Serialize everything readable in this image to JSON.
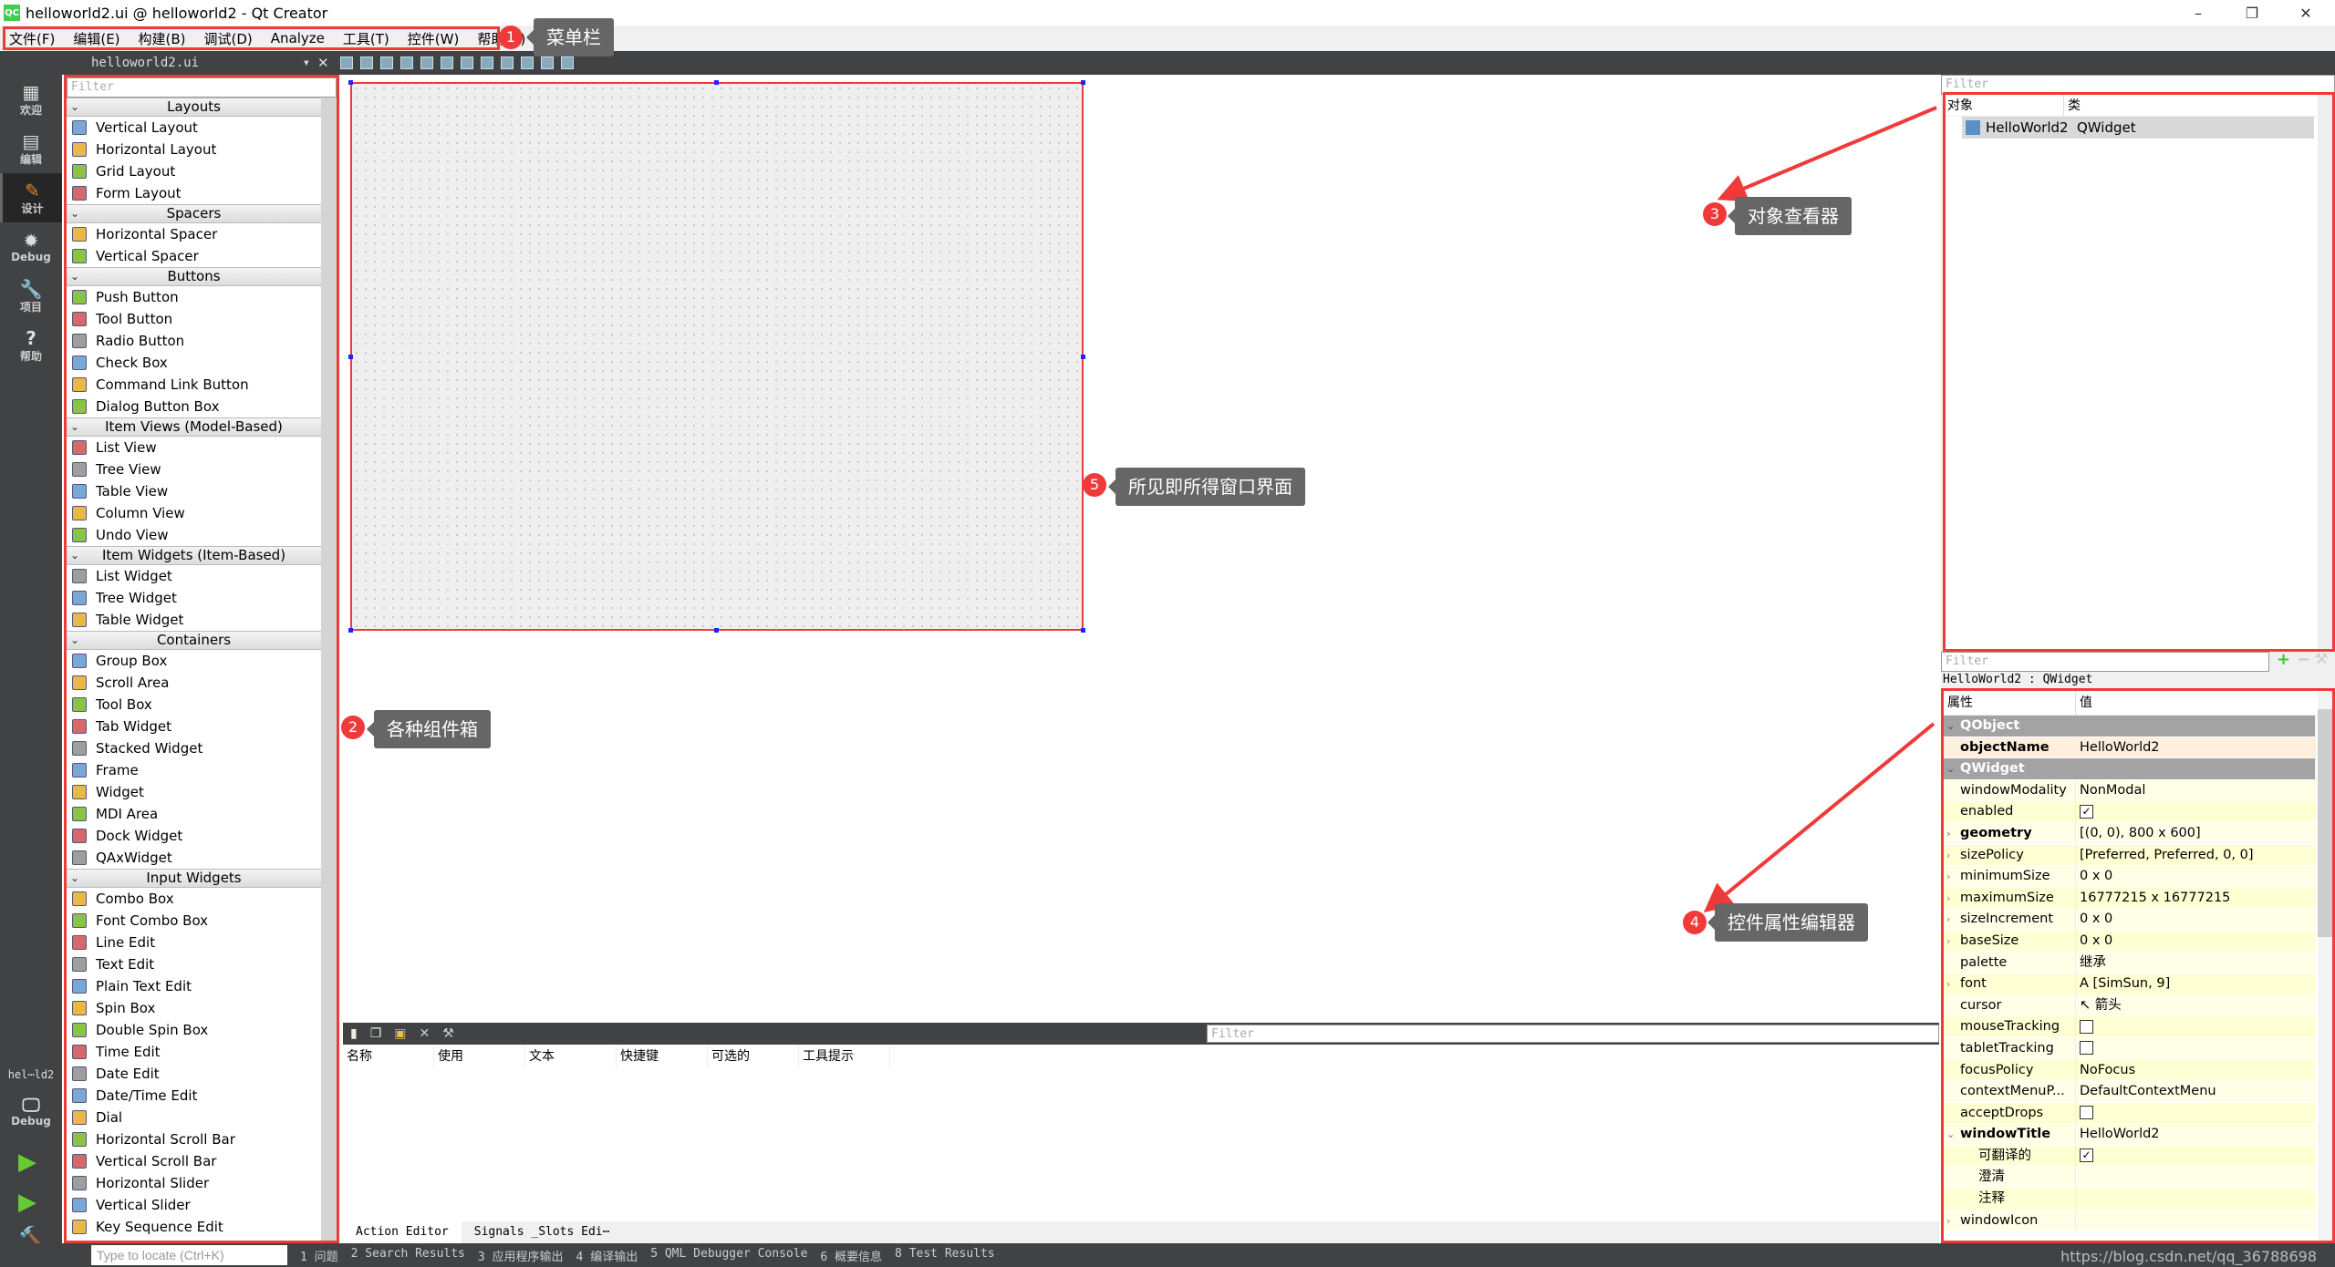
{
  "window": {
    "title": "helloworld2.ui @ helloworld2 - Qt Creator",
    "app_icon": "QC",
    "minimize": "–",
    "restore": "❐",
    "close": "✕"
  },
  "menu": [
    "文件(F)",
    "编辑(E)",
    "构建(B)",
    "调试(D)",
    "Analyze",
    "工具(T)",
    "控件(W)",
    "帮助(H)"
  ],
  "toolbar": {
    "file": "helloworld2.ui",
    "dropdown": "▾",
    "close": "✕"
  },
  "modes": [
    {
      "label": "欢迎",
      "icon": "▦"
    },
    {
      "label": "编辑",
      "icon": "▤"
    },
    {
      "label": "设计",
      "icon": "✎"
    },
    {
      "label": "Debug",
      "icon": "✹"
    },
    {
      "label": "项目",
      "icon": "🔧"
    },
    {
      "label": "帮助",
      "icon": "?"
    }
  ],
  "target": {
    "name": "hel⋯ld2",
    "mode": "Debug"
  },
  "widgetbox": {
    "filter_placeholder": "Filter",
    "categories": [
      {
        "name": "Layouts",
        "items": [
          "Vertical Layout",
          "Horizontal Layout",
          "Grid Layout",
          "Form Layout"
        ]
      },
      {
        "name": "Spacers",
        "items": [
          "Horizontal Spacer",
          "Vertical Spacer"
        ]
      },
      {
        "name": "Buttons",
        "items": [
          "Push Button",
          "Tool Button",
          "Radio Button",
          "Check Box",
          "Command Link Button",
          "Dialog Button Box"
        ]
      },
      {
        "name": "Item Views (Model-Based)",
        "items": [
          "List View",
          "Tree View",
          "Table View",
          "Column View",
          "Undo View"
        ]
      },
      {
        "name": "Item Widgets (Item-Based)",
        "items": [
          "List Widget",
          "Tree Widget",
          "Table Widget"
        ]
      },
      {
        "name": "Containers",
        "items": [
          "Group Box",
          "Scroll Area",
          "Tool Box",
          "Tab Widget",
          "Stacked Widget",
          "Frame",
          "Widget",
          "MDI Area",
          "Dock Widget",
          "QAxWidget"
        ]
      },
      {
        "name": "Input Widgets",
        "items": [
          "Combo Box",
          "Font Combo Box",
          "Line Edit",
          "Text Edit",
          "Plain Text Edit",
          "Spin Box",
          "Double Spin Box",
          "Time Edit",
          "Date Edit",
          "Date/Time Edit",
          "Dial",
          "Horizontal Scroll Bar",
          "Vertical Scroll Bar",
          "Horizontal Slider",
          "Vertical Slider",
          "Key Sequence Edit"
        ]
      }
    ]
  },
  "action_editor": {
    "filter_placeholder": "Filter",
    "columns": [
      "名称",
      "使用",
      "文本",
      "快捷键",
      "可选的",
      "工具提示"
    ],
    "tabs": [
      "Action Editor",
      "Signals _Slots Edi⋯"
    ]
  },
  "object_inspector": {
    "filter_placeholder": "Filter",
    "columns": [
      "对象",
      "类"
    ],
    "rows": [
      {
        "object": "HelloWorld2",
        "class": "QWidget"
      }
    ]
  },
  "property_editor": {
    "filter_placeholder": "Filter",
    "context": "HelloWorld2 : QWidget",
    "columns": [
      "属性",
      "值"
    ],
    "rows": [
      {
        "type": "group",
        "key": "QObject"
      },
      {
        "key": "objectName",
        "value": "HelloWorld2",
        "bold": true,
        "obj": true
      },
      {
        "type": "group",
        "key": "QWidget"
      },
      {
        "key": "windowModality",
        "value": "NonModal"
      },
      {
        "key": "enabled",
        "check": true
      },
      {
        "key": "geometry",
        "value": "[(0, 0), 800 x 600]",
        "bold": true,
        "expand": "›"
      },
      {
        "key": "sizePolicy",
        "value": "[Preferred, Preferred, 0, 0]",
        "expand": "›"
      },
      {
        "key": "minimumSize",
        "value": "0 x 0",
        "expand": "›"
      },
      {
        "key": "maximumSize",
        "value": "16777215 x 16777215",
        "expand": "›"
      },
      {
        "key": "sizeIncrement",
        "value": "0 x 0",
        "expand": "›"
      },
      {
        "key": "baseSize",
        "value": "0 x 0",
        "expand": "›"
      },
      {
        "key": "palette",
        "value": "继承"
      },
      {
        "key": "font",
        "value": "A  [SimSun, 9]",
        "expand": "›"
      },
      {
        "key": "cursor",
        "value": "↖  箭头"
      },
      {
        "key": "mouseTracking",
        "check": false
      },
      {
        "key": "tabletTracking",
        "check": false
      },
      {
        "key": "focusPolicy",
        "value": "NoFocus"
      },
      {
        "key": "contextMenuP...",
        "value": "DefaultContextMenu"
      },
      {
        "key": "acceptDrops",
        "check": false
      },
      {
        "key": "windowTitle",
        "value": "HelloWorld2",
        "bold": true,
        "expand": "⌄"
      },
      {
        "key": "可翻译的",
        "check": true,
        "indent": true
      },
      {
        "key": "澄清",
        "value": "",
        "indent": true
      },
      {
        "key": "注释",
        "value": "",
        "indent": true
      },
      {
        "key": "windowIcon",
        "value": "",
        "expand": "›"
      }
    ]
  },
  "statusbar": {
    "locate_placeholder": "Type to locate (Ctrl+K)",
    "items": [
      "1 问题",
      "2 Search Results",
      "3 应用程序输出",
      "4 编译输出",
      "5 QML Debugger Console",
      "6 概要信息",
      "8 Test Results"
    ]
  },
  "annotations": [
    {
      "n": "1",
      "label": "菜单栏"
    },
    {
      "n": "2",
      "label": "各种组件箱"
    },
    {
      "n": "3",
      "label": "对象查看器"
    },
    {
      "n": "4",
      "label": "控件属性编辑器"
    },
    {
      "n": "5",
      "label": "所见即所得窗口界面"
    }
  ],
  "watermark": "https://blog.csdn.net/qq_36788698",
  "colors": {
    "highlight": "#f03a3a",
    "dark": "#404244",
    "property_row": "#ffffd4",
    "group_row": "#a3a3a3"
  }
}
